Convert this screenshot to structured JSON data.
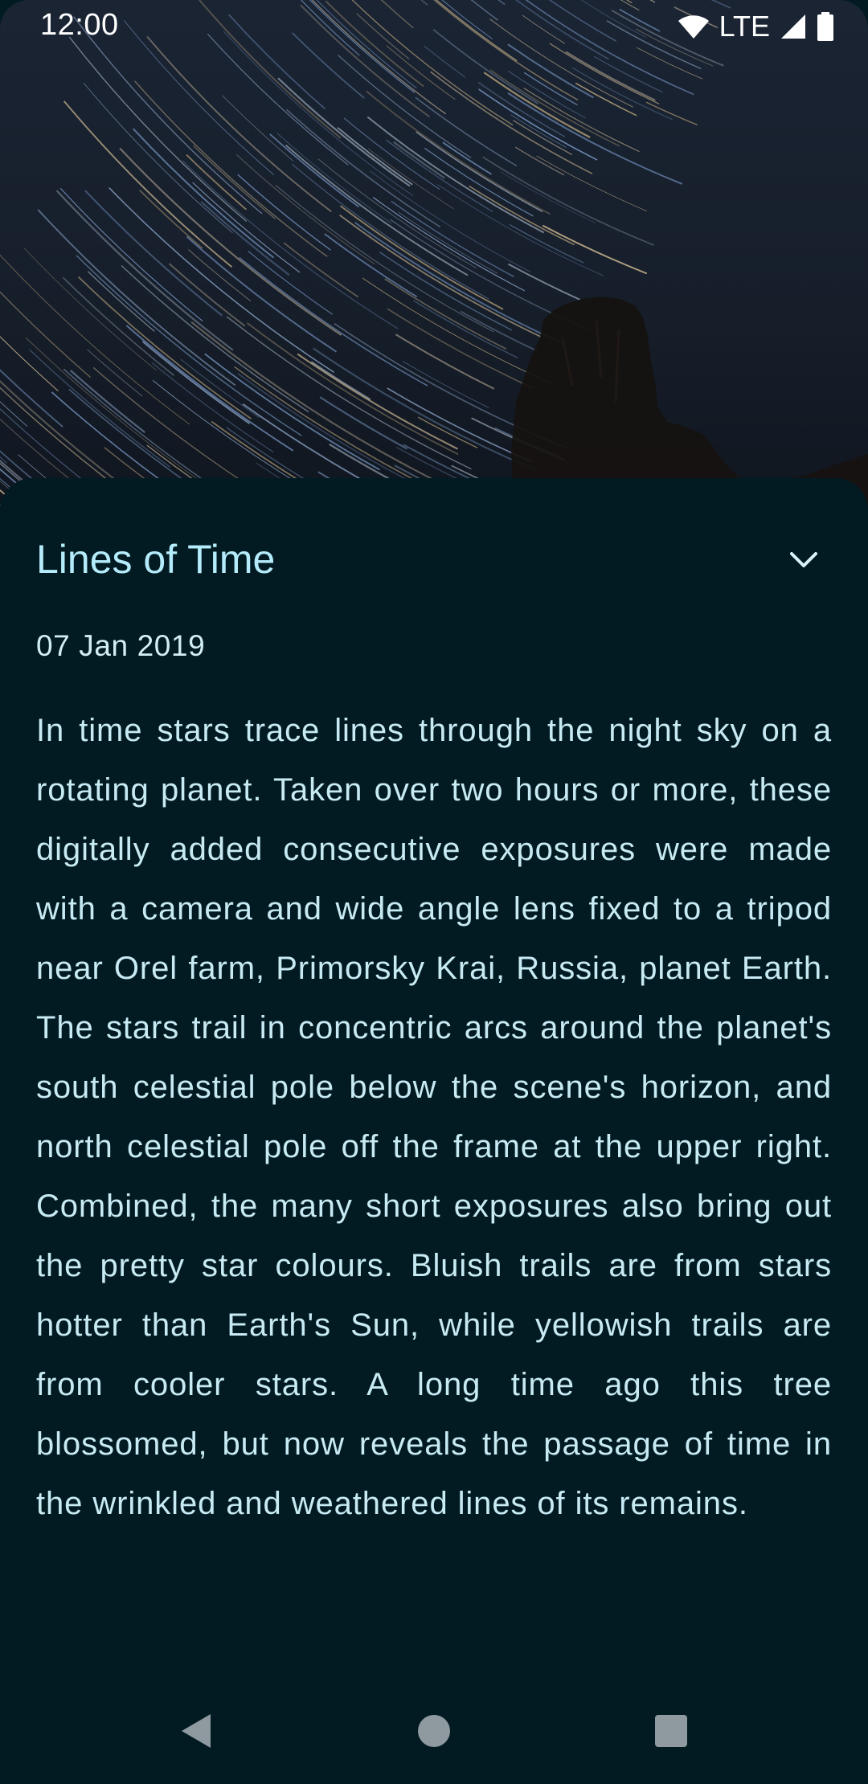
{
  "status_bar": {
    "time": "12:00",
    "network": "LTE",
    "icons": [
      "wifi-icon",
      "cell-signal-icon",
      "battery-icon"
    ]
  },
  "hero": {
    "image": "star-trails-photo"
  },
  "detail": {
    "title": "Lines of Time",
    "date": "07 Jan 2019",
    "description": "In time stars trace lines through the night sky on a rotating planet. Taken over two hours or more, these digitally added consecutive exposures were made with a camera and wide angle lens fixed to a tripod near Orel farm, Primorsky Krai, Russia, planet Earth. The stars trail in concentric arcs around the planet's south celestial pole below the scene's horizon, and north celestial pole off the frame at the upper right. Combined, the many short exposures also bring out the pretty star colours. Bluish trails are from stars hotter than Earth's Sun, while yellowish trails are from cooler stars. A long time ago this tree blossomed, but now reveals the passage of time in the wrinkled and weathered lines of its remains.",
    "collapse_icon": "chevron-down-icon"
  },
  "nav_bar": {
    "icons": [
      "back-icon",
      "home-icon",
      "recents-icon"
    ]
  },
  "colors": {
    "sheet_background": "#021b22",
    "title": "#b5ecfb",
    "body_text": "#c7eaf3"
  }
}
